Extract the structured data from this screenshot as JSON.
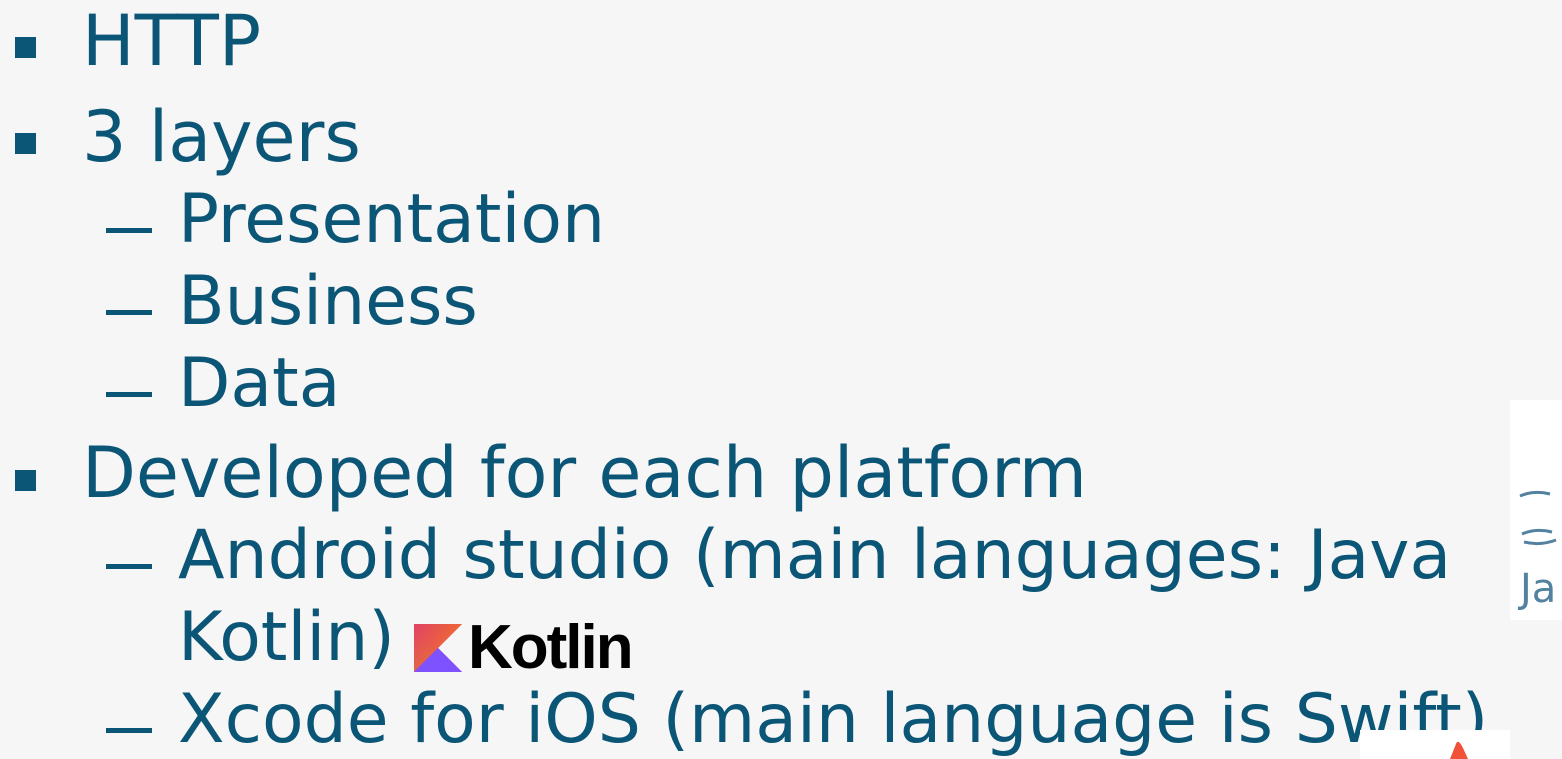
{
  "items": {
    "http": "HTTP",
    "layers": "3 layers",
    "presentation": "Presentation",
    "business": "Business",
    "data": "Data",
    "developed": "Developed for each platform",
    "android_line1": "Android studio (main languages: Java",
    "android_line2": "Kotlin)",
    "xcode": "Xcode for iOS (main language is Swift)"
  },
  "logos": {
    "kotlin_text": "Kotlin",
    "java_text": "Ja"
  },
  "colors": {
    "text": "#0b5576",
    "background": "#f6f6f6",
    "kotlin_orange": "#f88909",
    "kotlin_purple": "#7f52ff",
    "kotlin_magenta": "#e44857",
    "java_blue": "#5382a1",
    "swift_orange": "#f05138"
  }
}
